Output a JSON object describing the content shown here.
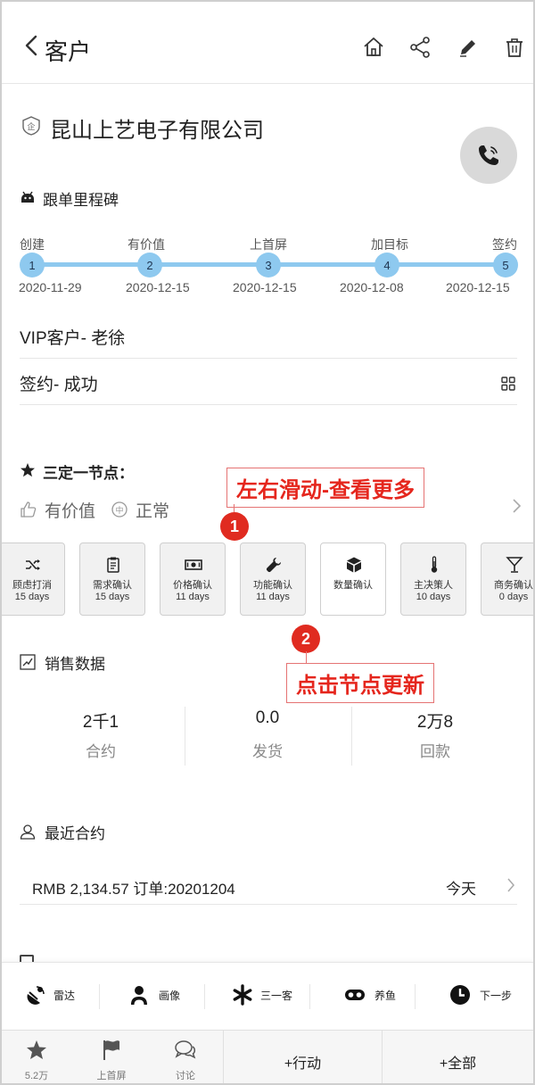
{
  "header": {
    "title": "客户",
    "icons": [
      "chevron-left-icon",
      "home-icon",
      "share-icon",
      "edit-icon",
      "trash-icon"
    ]
  },
  "company": {
    "name": "昆山上艺电子有限公司"
  },
  "milestone": {
    "heading": "跟单里程碑",
    "steps": [
      {
        "label": "创建",
        "num": "1",
        "date": "2020-11-29"
      },
      {
        "label": "有价值",
        "num": "2",
        "date": "2020-12-15"
      },
      {
        "label": "上首屏",
        "num": "3",
        "date": "2020-12-15"
      },
      {
        "label": "加目标",
        "num": "4",
        "date": "2020-12-08"
      },
      {
        "label": "签约",
        "num": "5",
        "date": "2020-12-15"
      }
    ],
    "color": "#8ec9ef"
  },
  "info": {
    "vip": "VIP客户- 老徐",
    "sign": "签约- 成功"
  },
  "three_node": {
    "heading": "三定一节点：",
    "tags": [
      "有价值",
      "正常"
    ],
    "callout_scroll": "左右滑动-查看更多",
    "callout_click": "点击节点更新",
    "badge1": "1",
    "badge2": "2",
    "nodes": [
      {
        "name": "顾虑打消",
        "days": "15 days",
        "icon": "shuffle-icon"
      },
      {
        "name": "需求确认",
        "days": "15 days",
        "icon": "clipboard-icon"
      },
      {
        "name": "价格确认",
        "days": "11 days",
        "icon": "money-icon"
      },
      {
        "name": "功能确认",
        "days": "11 days",
        "icon": "wrench-icon"
      },
      {
        "name": "数量确认",
        "days": "",
        "icon": "box-icon"
      },
      {
        "name": "主决策人",
        "days": "10 days",
        "icon": "thermometer-icon"
      },
      {
        "name": "商务确认",
        "days": "0 days",
        "icon": "cocktail-icon"
      }
    ]
  },
  "sales": {
    "heading": "销售数据",
    "stats": [
      {
        "value": "2千1",
        "label": "合约"
      },
      {
        "value": "0.0",
        "label": "发货"
      },
      {
        "value": "2万8",
        "label": "回款"
      }
    ]
  },
  "recent": {
    "heading": "最近合约",
    "amount": "RMB 2,134.57  订单:20201204",
    "when": "今天"
  },
  "actions": [
    {
      "label": "雷达",
      "icon": "radar-icon"
    },
    {
      "label": "画像",
      "icon": "user-icon"
    },
    {
      "label": "三一客",
      "icon": "asterisk-icon"
    },
    {
      "label": "养鱼",
      "icon": "fish-icon"
    },
    {
      "label": "下一步",
      "icon": "clock-icon"
    }
  ],
  "tabs": [
    {
      "label": "5.2万",
      "icon": "star-icon"
    },
    {
      "label": "上首屏",
      "icon": "flag-icon"
    },
    {
      "label": "讨论",
      "icon": "chat-icon"
    }
  ],
  "buttons": {
    "action": "+行动",
    "all": "+全部"
  },
  "colors": {
    "callout": "#e5261d",
    "badge": "#e02b20",
    "track": "#8ec9ef"
  }
}
